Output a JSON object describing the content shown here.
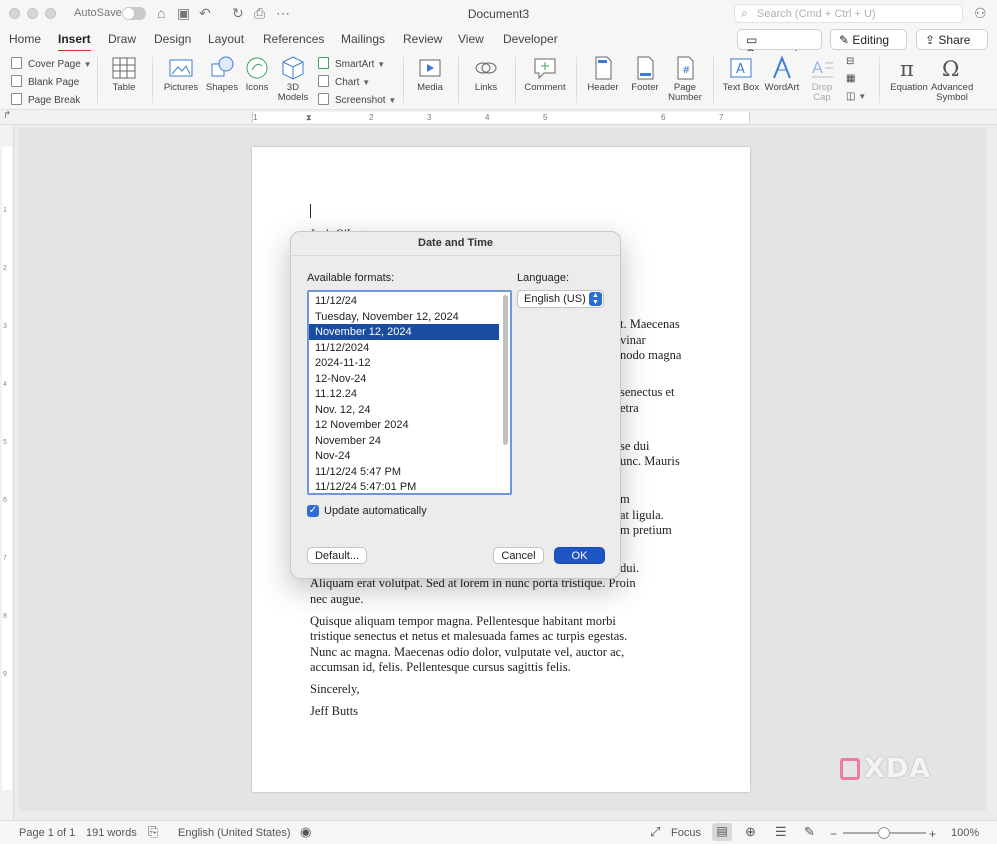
{
  "window": {
    "title": "Document3",
    "autosave_label": "AutoSave",
    "search_placeholder": "Search (Cmd + Ctrl + U)"
  },
  "tabs": [
    "Home",
    "Insert",
    "Draw",
    "Design",
    "Layout",
    "References",
    "Mailings",
    "Review",
    "View",
    "Developer"
  ],
  "active_tab": "Insert",
  "header_buttons": {
    "comments": "Comments",
    "editing": "Editing",
    "share": "Share"
  },
  "ribbon": {
    "pages": [
      "Cover Page",
      "Blank Page",
      "Page Break"
    ],
    "table": "Table",
    "pictures": "Pictures",
    "shapes": "Shapes",
    "icons": "Icons",
    "models": "3D Models",
    "smart": [
      "SmartArt",
      "Chart",
      "Screenshot"
    ],
    "media": "Media",
    "links": "Links",
    "comment": "Comment",
    "header": "Header",
    "footer": "Footer",
    "page_number": "Page Number",
    "text_box": "Text Box",
    "wordart": "WordArt",
    "drop_cap": "Drop Cap",
    "equation": "Equation",
    "advanced_symbol": "Advanced Symbol"
  },
  "ruler_numbers": [
    "1",
    "2",
    "3",
    "4",
    "5",
    "6",
    "7"
  ],
  "vruler_numbers": [
    "1",
    "2",
    "3",
    "4",
    "5",
    "6",
    "7",
    "8",
    "9"
  ],
  "document": {
    "partial_heading": "Jack O'Lantern",
    "right_fragments": [
      "t. Maecenas",
      "vinar",
      "nodo magna",
      "senectus et",
      "etra",
      "se dui",
      "unc. Mauris",
      "m",
      "at ligula.",
      "m pretium",
      "dui."
    ],
    "lines": [
      "Aliquam erat volutpat. Sed at lorem in nunc porta tristique. Proin",
      "nec augue.",
      "Quisque aliquam tempor magna. Pellentesque habitant morbi",
      "tristique senectus et netus et malesuada fames ac turpis egestas.",
      "Nunc ac magna. Maecenas odio dolor, vulputate vel, auctor ac,",
      "accumsan id, felis. Pellentesque cursus sagittis felis.",
      "Sincerely,",
      "Jeff Butts"
    ]
  },
  "dialog": {
    "title": "Date and Time",
    "formats_label": "Available formats:",
    "language_label": "Language:",
    "language_value": "English (US)",
    "formats": [
      "11/12/24",
      "Tuesday, November 12, 2024",
      "November 12, 2024",
      "11/12/2024",
      "2024-11-12",
      "12-Nov-24",
      "11.12.24",
      "Nov. 12, 24",
      "12 November 2024",
      "November 24",
      "Nov-24",
      "11/12/24 5:47 PM",
      "11/12/24 5:47:01 PM"
    ],
    "selected_format": "November 12, 2024",
    "update_auto_label": "Update automatically",
    "update_auto_checked": true,
    "default_button": "Default...",
    "cancel_button": "Cancel",
    "ok_button": "OK"
  },
  "status": {
    "page": "Page 1 of 1",
    "words": "191 words",
    "language": "English (United States)",
    "focus": "Focus",
    "zoom": "100%"
  },
  "watermark": "XDA"
}
